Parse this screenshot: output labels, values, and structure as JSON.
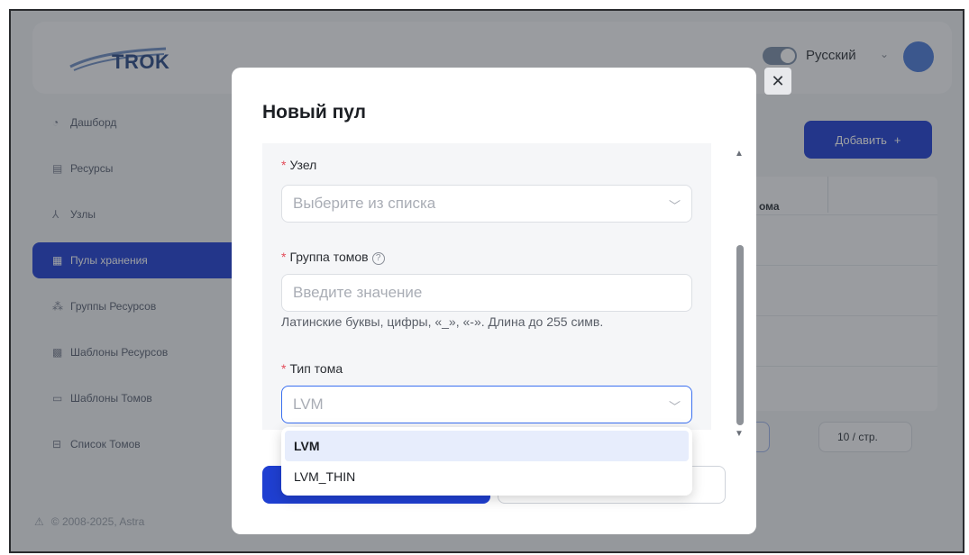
{
  "app": {
    "logo_text": "TROK",
    "language": "Русский",
    "copyright": "© 2008-2025, Astra"
  },
  "sidebar": {
    "items": [
      {
        "label": "Дашборд",
        "icon": "dashboard-icon",
        "active": false
      },
      {
        "label": "Ресурсы",
        "icon": "resources-icon",
        "active": false
      },
      {
        "label": "Узлы",
        "icon": "nodes-icon",
        "active": false
      },
      {
        "label": "Пулы хранения",
        "icon": "storage-pool-icon",
        "active": true
      },
      {
        "label": "Группы Ресурсов",
        "icon": "resource-groups-icon",
        "active": false
      },
      {
        "label": "Шаблоны Ресурсов",
        "icon": "resource-templates-icon",
        "active": false
      },
      {
        "label": "Шаблоны Томов",
        "icon": "volume-templates-icon",
        "active": false
      },
      {
        "label": "Список Томов",
        "icon": "volume-list-icon",
        "active": false
      }
    ]
  },
  "content": {
    "add_button": "Добавить",
    "column_header": "ома",
    "page_size": "10 / стр."
  },
  "modal": {
    "title": "Новый пул",
    "node": {
      "label": "Узел",
      "placeholder": "Выберите из списка"
    },
    "volume_group": {
      "label": "Группа томов",
      "placeholder": "Введите значение",
      "hint": "Латинские буквы, цифры, «_», «-». Длина до 255 симв."
    },
    "volume_type": {
      "label": "Тип тома",
      "value": "LVM",
      "options": [
        "LVM",
        "LVM_THIN"
      ],
      "selected_index": 0
    }
  },
  "colors": {
    "primary": "#1f3fd1",
    "required": "#e34c5a",
    "focus": "#3a6ff0",
    "selected_option_bg": "#e7edfc"
  }
}
